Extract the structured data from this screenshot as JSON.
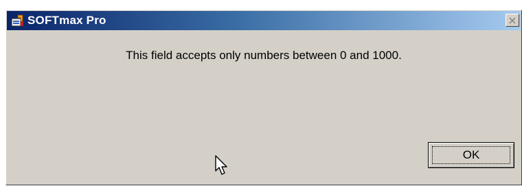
{
  "window": {
    "title": "SOFTmax Pro",
    "close_glyph": "✕"
  },
  "dialog": {
    "message": "This field accepts only numbers between 0 and 1000.",
    "ok_label": "OK"
  },
  "icons": {
    "app": "softmax-app-icon",
    "close": "close-icon",
    "cursor": "mouse-pointer-icon"
  },
  "colors": {
    "titlebar_start": "#0a246a",
    "titlebar_end": "#a6caf0",
    "dialog_face": "#d4d0c8"
  }
}
